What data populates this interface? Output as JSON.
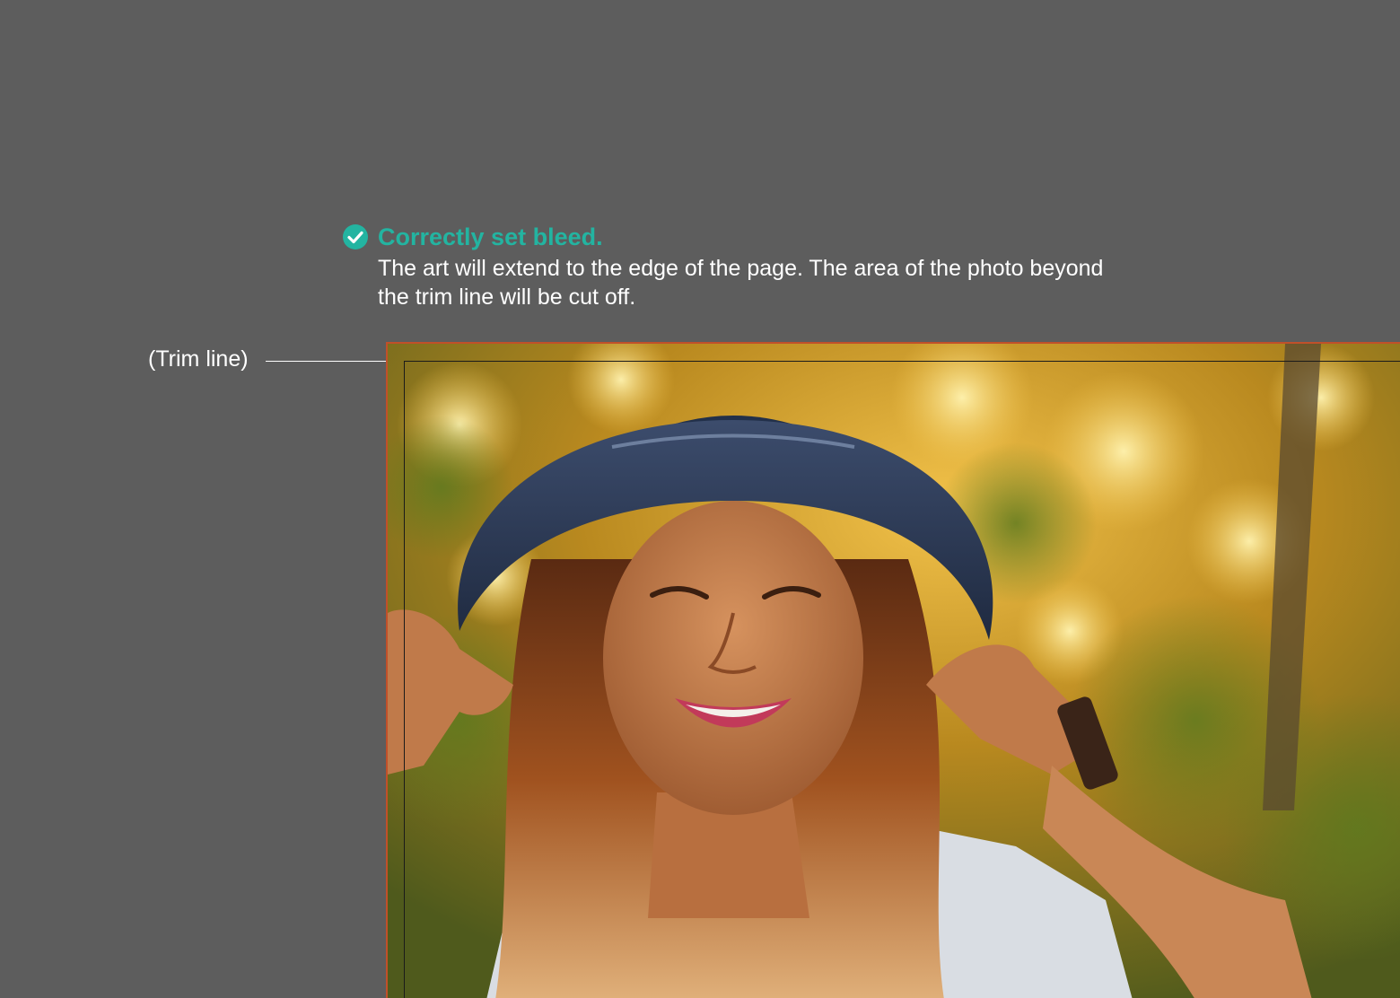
{
  "callout": {
    "icon": "check-circle-icon",
    "title": "Correctly set bleed.",
    "body": "The art will extend to the edge of the page. The area of the photo beyond the trim line will be cut off."
  },
  "trim_label": "(Trim line)",
  "photo": {
    "description_icon": "photo"
  },
  "colors": {
    "background": "#5d5d5d",
    "accent": "#23b4a1",
    "bleed_edge": "#c0502a",
    "trim_line": "#1a1a1a",
    "text": "#ffffff"
  }
}
